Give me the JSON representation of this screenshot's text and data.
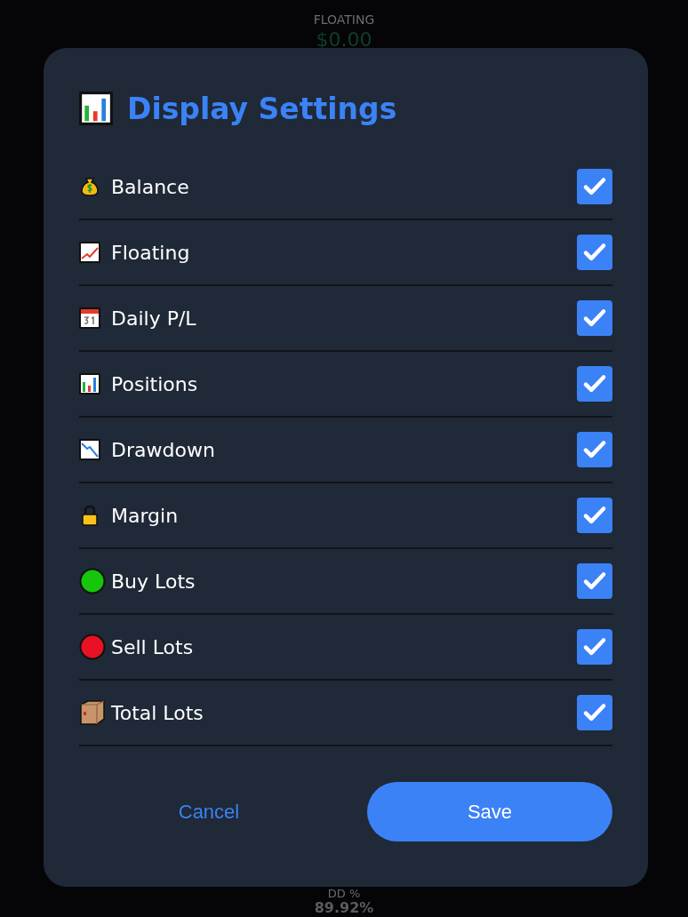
{
  "background": {
    "top": {
      "label": "FLOATING",
      "value": "$0.00"
    },
    "bottom": {
      "label": "DD %",
      "value": "89.92%"
    }
  },
  "dialog": {
    "title": "Display Settings",
    "options": [
      {
        "label": "Balance",
        "checked": true
      },
      {
        "label": "Floating",
        "checked": true
      },
      {
        "label": "Daily P/L",
        "checked": true
      },
      {
        "label": "Positions",
        "checked": true
      },
      {
        "label": "Drawdown",
        "checked": true
      },
      {
        "label": "Margin",
        "checked": true
      },
      {
        "label": "Buy Lots",
        "checked": true
      },
      {
        "label": "Sell Lots",
        "checked": true
      },
      {
        "label": "Total Lots",
        "checked": true
      }
    ],
    "buttons": {
      "cancel": "Cancel",
      "save": "Save"
    }
  }
}
